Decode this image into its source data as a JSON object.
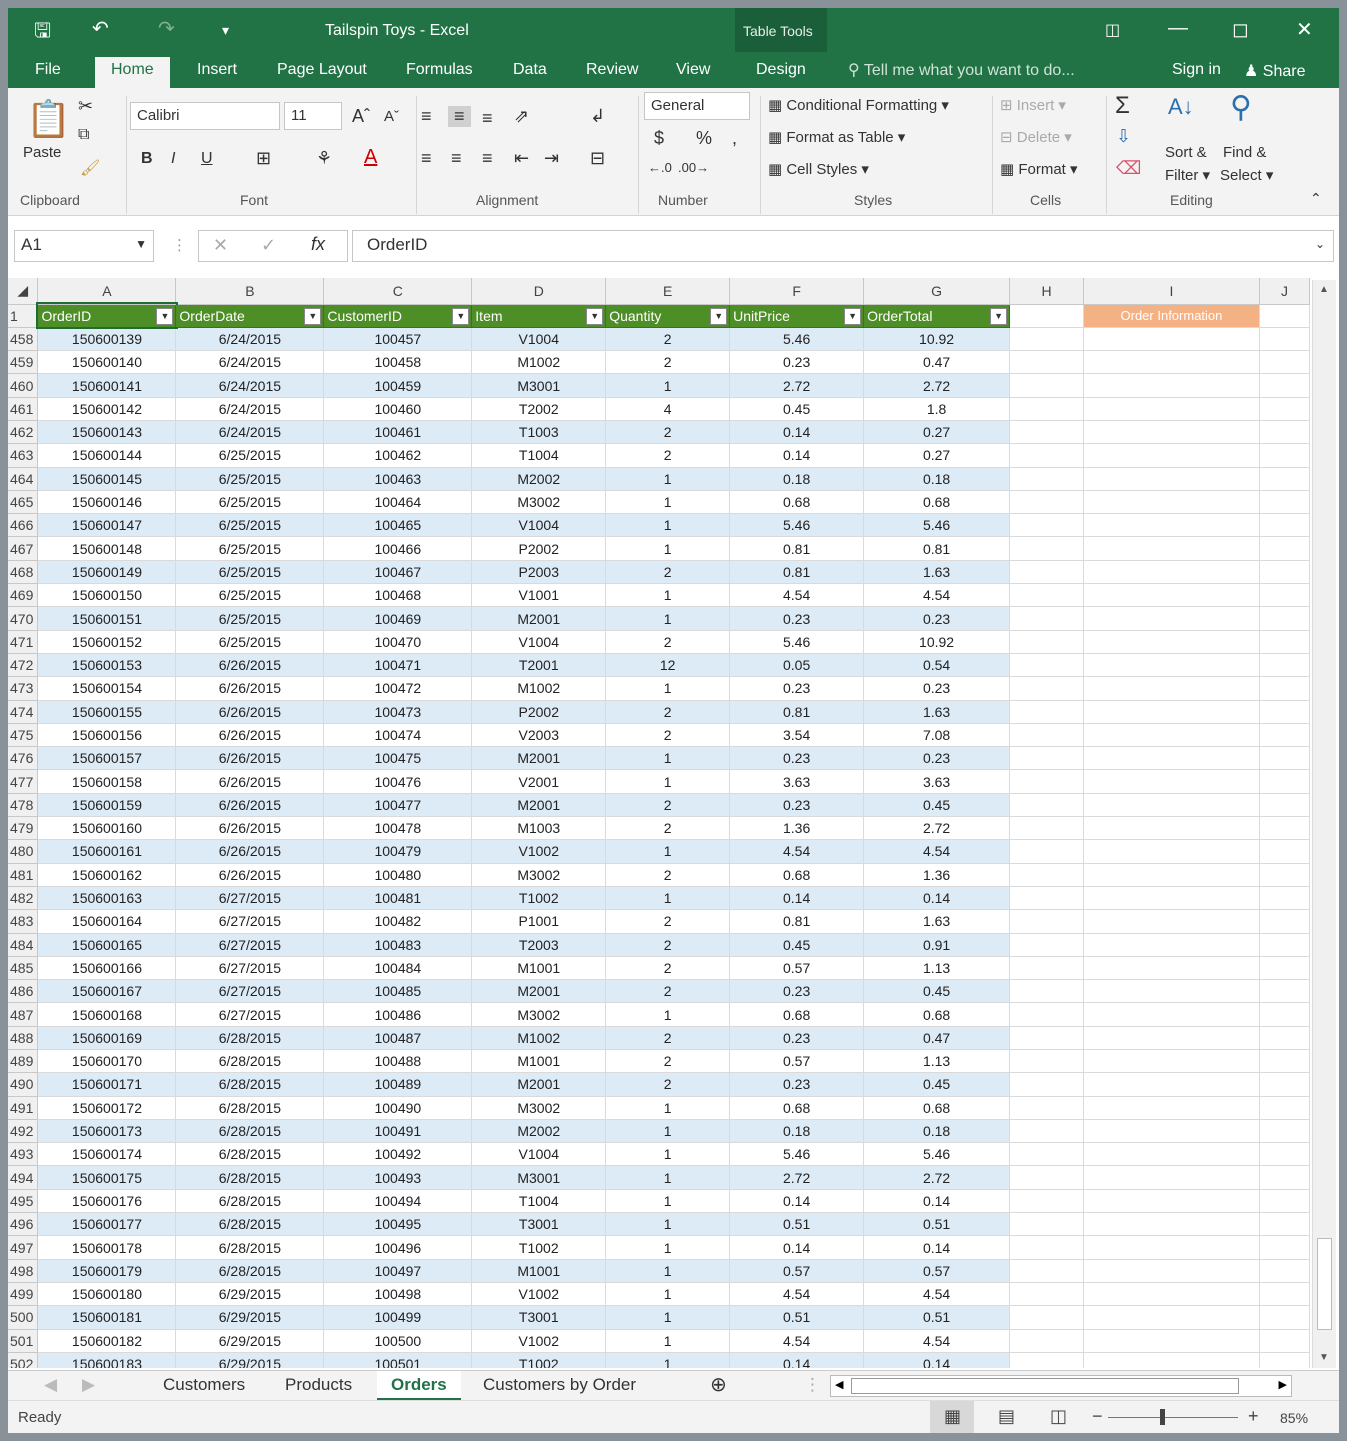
{
  "title": "Tailspin Toys - Excel",
  "context_tab": "Table Tools",
  "tabs": [
    "File",
    "Home",
    "Insert",
    "Page Layout",
    "Formulas",
    "Data",
    "Review",
    "View",
    "Design"
  ],
  "tell_me": "Tell me what you want to do...",
  "sign_in": "Sign in",
  "share": "Share",
  "clipboard": {
    "paste": "Paste",
    "label": "Clipboard"
  },
  "font": {
    "name": "Calibri",
    "size": "11",
    "bold": "B",
    "italic": "I",
    "underline": "U",
    "label": "Font"
  },
  "alignment": {
    "label": "Alignment"
  },
  "number": {
    "format": "General",
    "label": "Number"
  },
  "styles": {
    "cond": "Conditional Formatting",
    "fmt_table": "Format as Table",
    "cell_styles": "Cell Styles",
    "label": "Styles"
  },
  "cells": {
    "insert": "Insert",
    "delete": "Delete",
    "format": "Format",
    "label": "Cells"
  },
  "editing": {
    "sort": "Sort &",
    "filter": "Filter",
    "find": "Find &",
    "select": "Select",
    "label": "Editing"
  },
  "namebox": "A1",
  "formula": "OrderID",
  "col_letters": [
    "A",
    "B",
    "C",
    "D",
    "E",
    "F",
    "G",
    "H",
    "I",
    "J"
  ],
  "headers": [
    "OrderID",
    "OrderDate",
    "CustomerID",
    "Item",
    "Quantity",
    "UnitPrice",
    "OrderTotal"
  ],
  "order_info": "Order Information",
  "rows": [
    [
      "458",
      "150600139",
      "6/24/2015",
      "100457",
      "V1004",
      "2",
      "5.46",
      "10.92"
    ],
    [
      "459",
      "150600140",
      "6/24/2015",
      "100458",
      "M1002",
      "2",
      "0.23",
      "0.47"
    ],
    [
      "460",
      "150600141",
      "6/24/2015",
      "100459",
      "M3001",
      "1",
      "2.72",
      "2.72"
    ],
    [
      "461",
      "150600142",
      "6/24/2015",
      "100460",
      "T2002",
      "4",
      "0.45",
      "1.8"
    ],
    [
      "462",
      "150600143",
      "6/24/2015",
      "100461",
      "T1003",
      "2",
      "0.14",
      "0.27"
    ],
    [
      "463",
      "150600144",
      "6/25/2015",
      "100462",
      "T1004",
      "2",
      "0.14",
      "0.27"
    ],
    [
      "464",
      "150600145",
      "6/25/2015",
      "100463",
      "M2002",
      "1",
      "0.18",
      "0.18"
    ],
    [
      "465",
      "150600146",
      "6/25/2015",
      "100464",
      "M3002",
      "1",
      "0.68",
      "0.68"
    ],
    [
      "466",
      "150600147",
      "6/25/2015",
      "100465",
      "V1004",
      "1",
      "5.46",
      "5.46"
    ],
    [
      "467",
      "150600148",
      "6/25/2015",
      "100466",
      "P2002",
      "1",
      "0.81",
      "0.81"
    ],
    [
      "468",
      "150600149",
      "6/25/2015",
      "100467",
      "P2003",
      "2",
      "0.81",
      "1.63"
    ],
    [
      "469",
      "150600150",
      "6/25/2015",
      "100468",
      "V1001",
      "1",
      "4.54",
      "4.54"
    ],
    [
      "470",
      "150600151",
      "6/25/2015",
      "100469",
      "M2001",
      "1",
      "0.23",
      "0.23"
    ],
    [
      "471",
      "150600152",
      "6/25/2015",
      "100470",
      "V1004",
      "2",
      "5.46",
      "10.92"
    ],
    [
      "472",
      "150600153",
      "6/26/2015",
      "100471",
      "T2001",
      "12",
      "0.05",
      "0.54"
    ],
    [
      "473",
      "150600154",
      "6/26/2015",
      "100472",
      "M1002",
      "1",
      "0.23",
      "0.23"
    ],
    [
      "474",
      "150600155",
      "6/26/2015",
      "100473",
      "P2002",
      "2",
      "0.81",
      "1.63"
    ],
    [
      "475",
      "150600156",
      "6/26/2015",
      "100474",
      "V2003",
      "2",
      "3.54",
      "7.08"
    ],
    [
      "476",
      "150600157",
      "6/26/2015",
      "100475",
      "M2001",
      "1",
      "0.23",
      "0.23"
    ],
    [
      "477",
      "150600158",
      "6/26/2015",
      "100476",
      "V2001",
      "1",
      "3.63",
      "3.63"
    ],
    [
      "478",
      "150600159",
      "6/26/2015",
      "100477",
      "M2001",
      "2",
      "0.23",
      "0.45"
    ],
    [
      "479",
      "150600160",
      "6/26/2015",
      "100478",
      "M1003",
      "2",
      "1.36",
      "2.72"
    ],
    [
      "480",
      "150600161",
      "6/26/2015",
      "100479",
      "V1002",
      "1",
      "4.54",
      "4.54"
    ],
    [
      "481",
      "150600162",
      "6/26/2015",
      "100480",
      "M3002",
      "2",
      "0.68",
      "1.36"
    ],
    [
      "482",
      "150600163",
      "6/27/2015",
      "100481",
      "T1002",
      "1",
      "0.14",
      "0.14"
    ],
    [
      "483",
      "150600164",
      "6/27/2015",
      "100482",
      "P1001",
      "2",
      "0.81",
      "1.63"
    ],
    [
      "484",
      "150600165",
      "6/27/2015",
      "100483",
      "T2003",
      "2",
      "0.45",
      "0.91"
    ],
    [
      "485",
      "150600166",
      "6/27/2015",
      "100484",
      "M1001",
      "2",
      "0.57",
      "1.13"
    ],
    [
      "486",
      "150600167",
      "6/27/2015",
      "100485",
      "M2001",
      "2",
      "0.23",
      "0.45"
    ],
    [
      "487",
      "150600168",
      "6/27/2015",
      "100486",
      "M3002",
      "1",
      "0.68",
      "0.68"
    ],
    [
      "488",
      "150600169",
      "6/28/2015",
      "100487",
      "M1002",
      "2",
      "0.23",
      "0.47"
    ],
    [
      "489",
      "150600170",
      "6/28/2015",
      "100488",
      "M1001",
      "2",
      "0.57",
      "1.13"
    ],
    [
      "490",
      "150600171",
      "6/28/2015",
      "100489",
      "M2001",
      "2",
      "0.23",
      "0.45"
    ],
    [
      "491",
      "150600172",
      "6/28/2015",
      "100490",
      "M3002",
      "1",
      "0.68",
      "0.68"
    ],
    [
      "492",
      "150600173",
      "6/28/2015",
      "100491",
      "M2002",
      "1",
      "0.18",
      "0.18"
    ],
    [
      "493",
      "150600174",
      "6/28/2015",
      "100492",
      "V1004",
      "1",
      "5.46",
      "5.46"
    ],
    [
      "494",
      "150600175",
      "6/28/2015",
      "100493",
      "M3001",
      "1",
      "2.72",
      "2.72"
    ],
    [
      "495",
      "150600176",
      "6/28/2015",
      "100494",
      "T1004",
      "1",
      "0.14",
      "0.14"
    ],
    [
      "496",
      "150600177",
      "6/28/2015",
      "100495",
      "T3001",
      "1",
      "0.51",
      "0.51"
    ],
    [
      "497",
      "150600178",
      "6/28/2015",
      "100496",
      "T1002",
      "1",
      "0.14",
      "0.14"
    ],
    [
      "498",
      "150600179",
      "6/28/2015",
      "100497",
      "M1001",
      "1",
      "0.57",
      "0.57"
    ],
    [
      "499",
      "150600180",
      "6/29/2015",
      "100498",
      "V1002",
      "1",
      "4.54",
      "4.54"
    ],
    [
      "500",
      "150600181",
      "6/29/2015",
      "100499",
      "T3001",
      "1",
      "0.51",
      "0.51"
    ],
    [
      "501",
      "150600182",
      "6/29/2015",
      "100500",
      "V1002",
      "1",
      "4.54",
      "4.54"
    ],
    [
      "502",
      "150600183",
      "6/29/2015",
      "100501",
      "T1002",
      "1",
      "0.14",
      "0.14"
    ]
  ],
  "sheets": [
    "Customers",
    "Products",
    "Orders",
    "Customers by Order"
  ],
  "status": "Ready",
  "zoom": "85%"
}
